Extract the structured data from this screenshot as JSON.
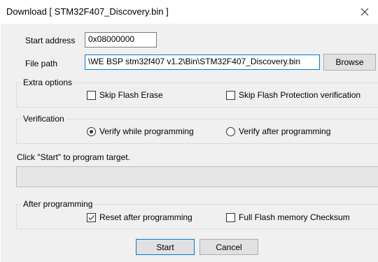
{
  "window": {
    "title": "Download [ STM32F407_Discovery.bin ]"
  },
  "fields": {
    "start_address_label": "Start address",
    "start_address_value": "0x08000000",
    "file_path_label": "File path",
    "file_path_value": "\\WE BSP stm32f407 v1.2\\Bin\\STM32F407_Discovery.bin",
    "browse_label": "Browse"
  },
  "extra_options": {
    "title": "Extra options",
    "skip_flash_erase": {
      "label": "Skip Flash Erase",
      "checked": false
    },
    "skip_protection": {
      "label": "Skip Flash Protection verification",
      "checked": false
    }
  },
  "verification": {
    "title": "Verification",
    "verify_while": {
      "label": "Verify while programming",
      "selected": true
    },
    "verify_after": {
      "label": "Verify after programming",
      "selected": false
    }
  },
  "status": {
    "message": "Click \"Start\" to program target.",
    "progress": 0
  },
  "after_programming": {
    "title": "After programming",
    "reset_after": {
      "label": "Reset after programming",
      "checked": true
    },
    "full_checksum": {
      "label": "Full Flash memory Checksum",
      "checked": false
    }
  },
  "buttons": {
    "start": "Start",
    "cancel": "Cancel"
  }
}
